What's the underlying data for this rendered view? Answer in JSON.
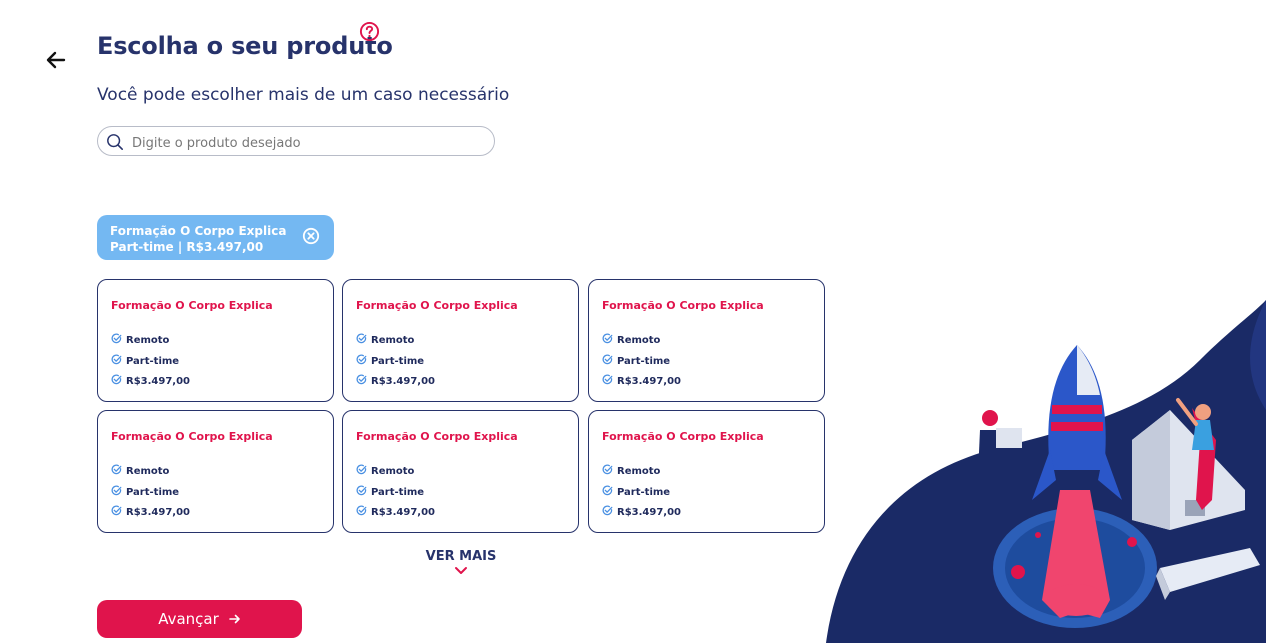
{
  "header": {
    "title": "Escolha o seu produto",
    "subtitle": "Você pode escolher mais de um caso necessário"
  },
  "search": {
    "placeholder": "Digite o produto desejado",
    "value": ""
  },
  "selected": [
    {
      "name": "Formação O Corpo Explica",
      "detail": "Part-time | R$3.497,00"
    }
  ],
  "products": [
    {
      "title": "Formação O Corpo Explica",
      "features": [
        "Remoto",
        "Part-time",
        "R$3.497,00"
      ]
    },
    {
      "title": "Formação O Corpo Explica",
      "features": [
        "Remoto",
        "Part-time",
        "R$3.497,00"
      ]
    },
    {
      "title": "Formação O Corpo Explica",
      "features": [
        "Remoto",
        "Part-time",
        "R$3.497,00"
      ]
    },
    {
      "title": "Formação O Corpo Explica",
      "features": [
        "Remoto",
        "Part-time",
        "R$3.497,00"
      ]
    },
    {
      "title": "Formação O Corpo Explica",
      "features": [
        "Remoto",
        "Part-time",
        "R$3.497,00"
      ]
    },
    {
      "title": "Formação O Corpo Explica",
      "features": [
        "Remoto",
        "Part-time",
        "R$3.497,00"
      ]
    }
  ],
  "see_more_label": "VER MAIS",
  "next_label": "Avançar",
  "icons": {
    "back": "arrow-left-icon",
    "help": "question-circle-icon",
    "search": "search-icon",
    "remove": "close-circle-icon",
    "feature": "check-circle-icon",
    "more": "chevron-down-icon",
    "next": "arrow-right-icon"
  },
  "colors": {
    "primary": "#27336b",
    "accent": "#e0144c",
    "chip": "#74b8f2",
    "feature_icon": "#4a90e2"
  }
}
